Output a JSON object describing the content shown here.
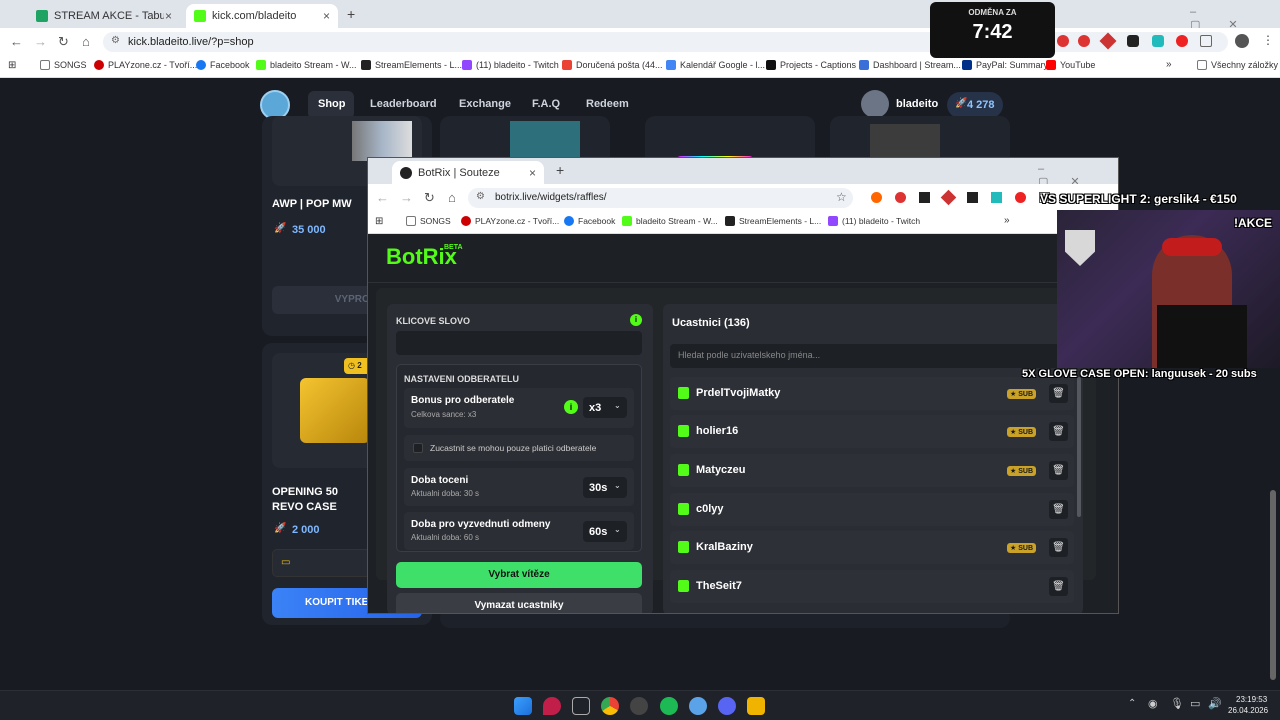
{
  "timer": {
    "label": "ODMĚNA ZA",
    "value": "7:42"
  },
  "outer_browser": {
    "tabs": [
      {
        "title": "STREAM AKCE - Tabulky Googl...",
        "color": "#1ea362"
      },
      {
        "title": "kick.com/bladeito",
        "color": "#53fc18"
      }
    ],
    "url": "kick.bladeito.live/?p=shop",
    "bookmarks": [
      "SONGS",
      "PLAYzone.cz - Tvoří...",
      "Facebook",
      "bladeito Stream - W...",
      "StreamElements - L...",
      "(11) bladeito - Twitch",
      "Doručená pošta (44...",
      "Kalendář Google - l...",
      "Projects - Captions",
      "Dashboard | Stream...",
      "PayPal: Summary",
      "YouTube"
    ],
    "all_bookmarks": "Všechny záložky"
  },
  "site": {
    "nav": [
      "Shop",
      "Leaderboard",
      "Exchange",
      "F.A.Q",
      "Redeem"
    ],
    "user": "bladeito",
    "balance": "4 278",
    "cards": [
      {
        "title": "AWP | POP MW",
        "price": "35 000",
        "button": "VYPRODÁNO"
      },
      {
        "title": "OPENING 50 REVO CASE",
        "price": "2 000",
        "button": "KOUPIT TIKET",
        "badge": "2"
      }
    ]
  },
  "botrix": {
    "tab_title": "BotRix | Souteze",
    "url": "botrix.live/widgets/raffles/",
    "bookmarks": [
      "SONGS",
      "PLAYzone.cz - Tvoří...",
      "Facebook",
      "bladeito Stream - W...",
      "StreamElements - L...",
      "(11) bladeito - Twitch"
    ],
    "logo": "BotRix",
    "beta": "BETA",
    "keyword_label": "KLICOVE SLOVO",
    "sub_settings_label": "NASTAVENI ODBERATELU",
    "bonus_title": "Bonus pro odberatele",
    "bonus_sub": "Celkova sance: x3",
    "bonus_value": "x3",
    "only_paid_label": "Zucastnit se mohou pouze platici odberatele",
    "spin_title": "Doba toceni",
    "spin_sub": "Aktualni doba: 30 s",
    "spin_value": "30s",
    "claim_title": "Doba pro vyzvednuti odmeny",
    "claim_sub": "Aktualni doba: 60 s",
    "claim_value": "60s",
    "pick_winner": "Vybrat vítěze",
    "clear_participants": "Vymazat ucastniky",
    "participants_title": "Ucastnici (136)",
    "search_placeholder": "Hledat podle uzivatelskeho jména...",
    "sub_badge": "SUB",
    "participants": [
      {
        "name": "PrdelTvojiMatky",
        "sub": true
      },
      {
        "name": "holier16",
        "sub": true
      },
      {
        "name": "Matyczeu",
        "sub": true
      },
      {
        "name": "c0lyy",
        "sub": false
      },
      {
        "name": "KralBaziny",
        "sub": true
      },
      {
        "name": "TheSeit7",
        "sub": false
      }
    ]
  },
  "overlay": {
    "ticker_top": "VS SUPERLIGHT 2: gerslik4 - €150",
    "akce": "!AKCE",
    "ticker_bottom": "5X GLOVE CASE OPEN: languusek - 20 subs"
  },
  "taskbar": {
    "time": "23:19:53",
    "date": "26.04.2026"
  }
}
